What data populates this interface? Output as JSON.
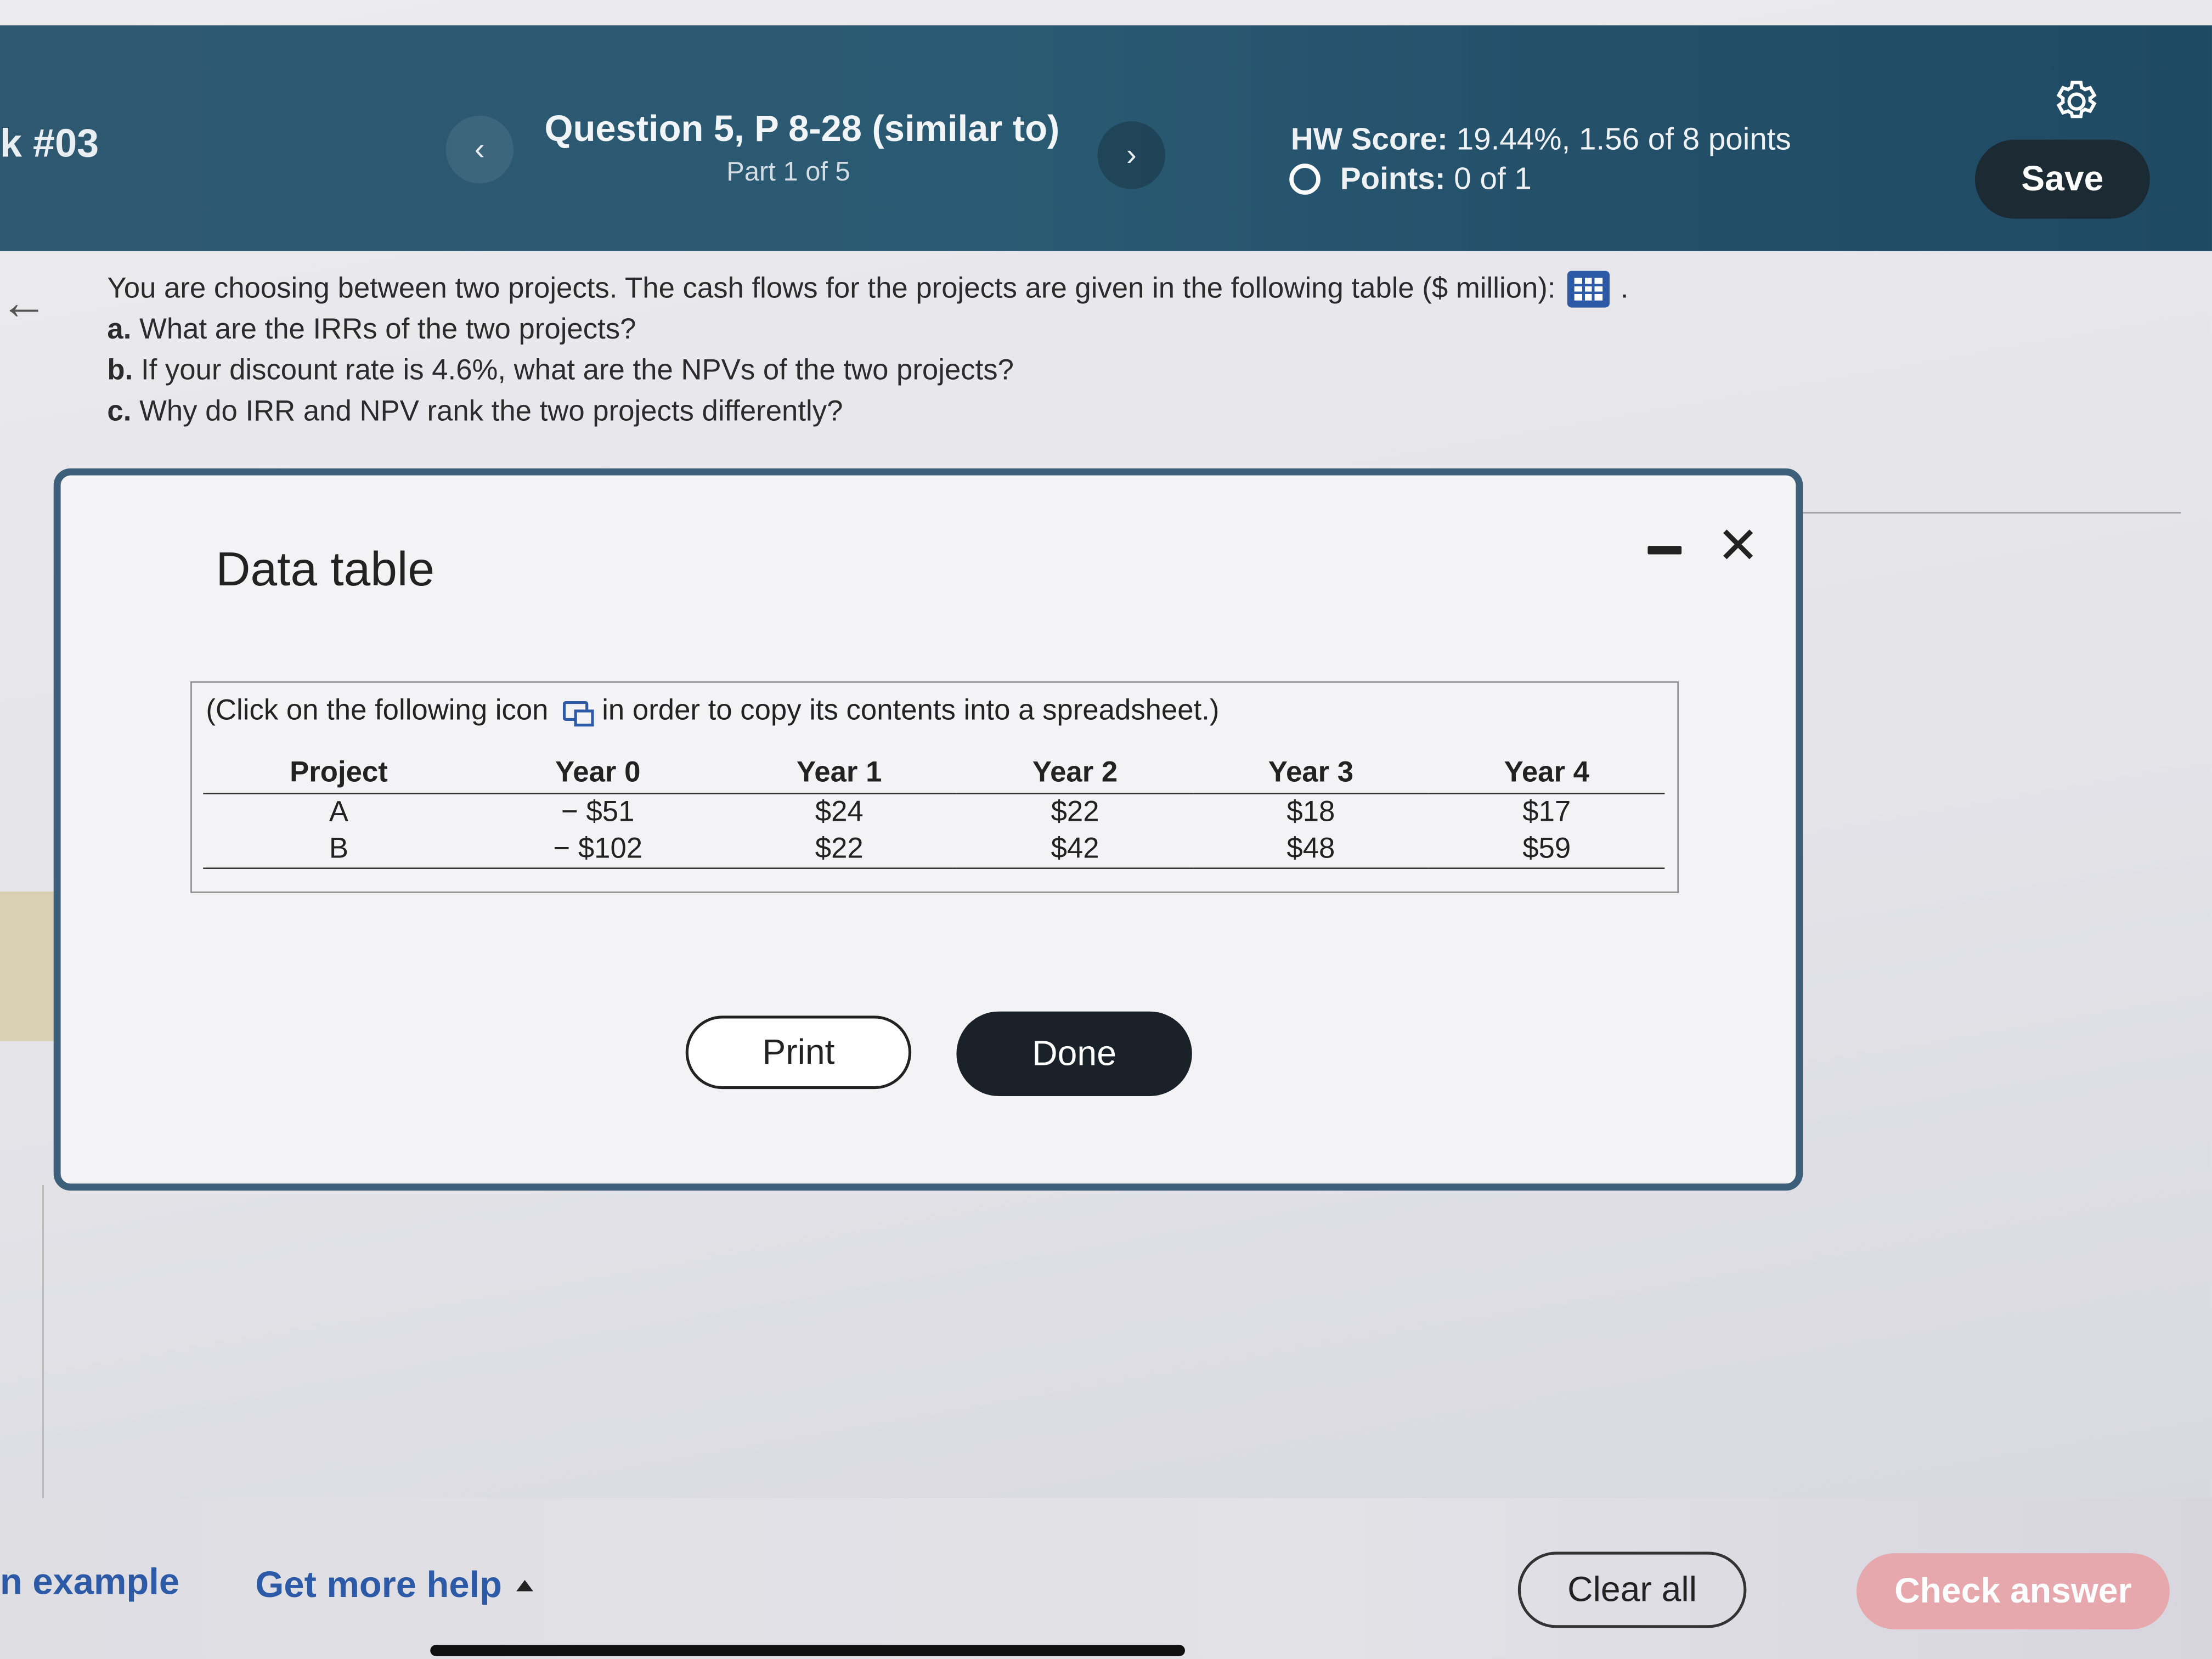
{
  "header": {
    "question_number": "k #03",
    "prev_label": "‹",
    "next_label": "›",
    "question_title": "Question 5, P 8-28 (similar to)",
    "part": "Part 1 of 5",
    "hw_score_label": "HW Score:",
    "hw_score_value": "19.44%, 1.56 of 8 points",
    "points_label": "Points:",
    "points_value": "0 of 1",
    "save_label": "Save"
  },
  "question": {
    "back_label": "←",
    "intro": "You are choosing between two projects. The cash flows for the projects are given in the following table ($ million):",
    "intro_end": ".",
    "items": [
      {
        "marker": "a.",
        "text": "What are the IRRs of the two projects?"
      },
      {
        "marker": "b.",
        "text": "If your discount rate is 4.6%, what are the NPVs of the two projects?"
      },
      {
        "marker": "c.",
        "text": "Why do IRR and NPV rank the two projects differently?"
      }
    ]
  },
  "modal": {
    "title": "Data table",
    "close_label": "✕",
    "copy_note_before": "(Click on the following icon",
    "copy_note_after": "in order to copy its contents into a spreadsheet.)",
    "table": {
      "headers": [
        "Project",
        "Year 0",
        "Year 1",
        "Year 2",
        "Year 3",
        "Year 4"
      ],
      "rows": [
        [
          "A",
          "− $51",
          "$24",
          "$22",
          "$18",
          "$17"
        ],
        [
          "B",
          "− $102",
          "$22",
          "$42",
          "$48",
          "$59"
        ]
      ]
    },
    "print_label": "Print",
    "done_label": "Done"
  },
  "footer": {
    "example_label": "n example",
    "help_label": "Get more help",
    "clear_label": "Clear all",
    "check_label": "Check answer"
  },
  "colors": {
    "header_bg": "#2a5a73",
    "link_blue": "#2d5aa6",
    "done_bg": "#1a2128",
    "check_bg": "#e6a8ad"
  }
}
